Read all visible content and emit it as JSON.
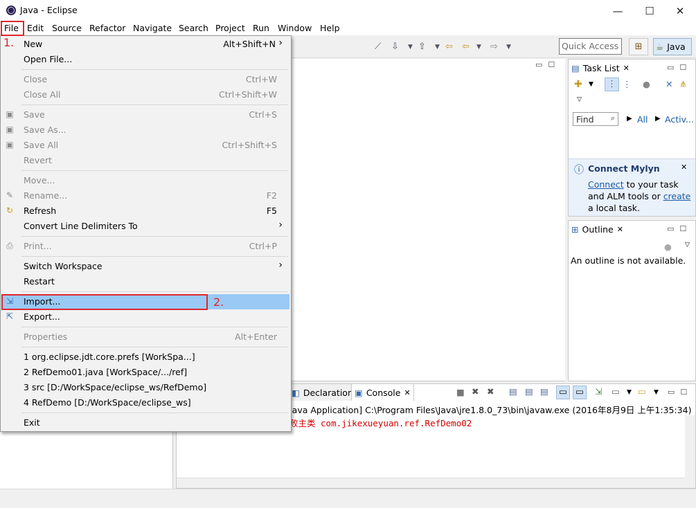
{
  "window": {
    "title": "Java - Eclipse",
    "minimize": "—",
    "maximize": "☐",
    "close": "✕"
  },
  "menubar": [
    "File",
    "Edit",
    "Source",
    "Refactor",
    "Navigate",
    "Search",
    "Project",
    "Run",
    "Window",
    "Help"
  ],
  "toolbar": {
    "quick_access": "Quick Access",
    "perspective": "Java"
  },
  "file_menu": {
    "new": {
      "label": "New",
      "shortcut": "Alt+Shift+N"
    },
    "open_file": "Open File...",
    "close": {
      "label": "Close",
      "shortcut": "Ctrl+W"
    },
    "close_all": {
      "label": "Close All",
      "shortcut": "Ctrl+Shift+W"
    },
    "save": {
      "label": "Save",
      "shortcut": "Ctrl+S"
    },
    "save_as": "Save As...",
    "save_all": {
      "label": "Save All",
      "shortcut": "Ctrl+Shift+S"
    },
    "revert": "Revert",
    "move": "Move...",
    "rename": {
      "label": "Rename...",
      "shortcut": "F2"
    },
    "refresh": {
      "label": "Refresh",
      "shortcut": "F5"
    },
    "convert": "Convert Line Delimiters To",
    "print": {
      "label": "Print...",
      "shortcut": "Ctrl+P"
    },
    "switch_workspace": "Switch Workspace",
    "restart": "Restart",
    "import": "Import...",
    "export": "Export...",
    "properties": {
      "label": "Properties",
      "shortcut": "Alt+Enter"
    },
    "recent": [
      "1 org.eclipse.jdt.core.prefs  [WorkSpa...]",
      "2 RefDemo01.java  [WorkSpace/.../ref]",
      "3 src  [D:/WorkSpace/eclipse_ws/RefDemo]",
      "4 RefDemo  [D:/WorkSpace/eclipse_ws]"
    ],
    "exit": "Exit"
  },
  "annotations": {
    "step1": "1.",
    "step2": "2."
  },
  "task_list": {
    "tab": "Task List",
    "find": "Find",
    "all": "All",
    "activate": "Activ..."
  },
  "mylyn": {
    "title": "Connect Mylyn",
    "link1": "Connect",
    "text1": " to your task and ALM tools or ",
    "link2": "create",
    "text2": " a local task."
  },
  "outline": {
    "tab": "Outline",
    "message": "An outline is not available."
  },
  "console": {
    "declaration_tab": "Declaration",
    "console_tab": "Console",
    "header": "Java Application] C:\\Program Files\\Java\\jre1.8.0_73\\bin\\javaw.exe (2016年8月9日 上午1:35:34)",
    "output": "败主类 com.jikexueyuan.ref.RefDemo02"
  }
}
